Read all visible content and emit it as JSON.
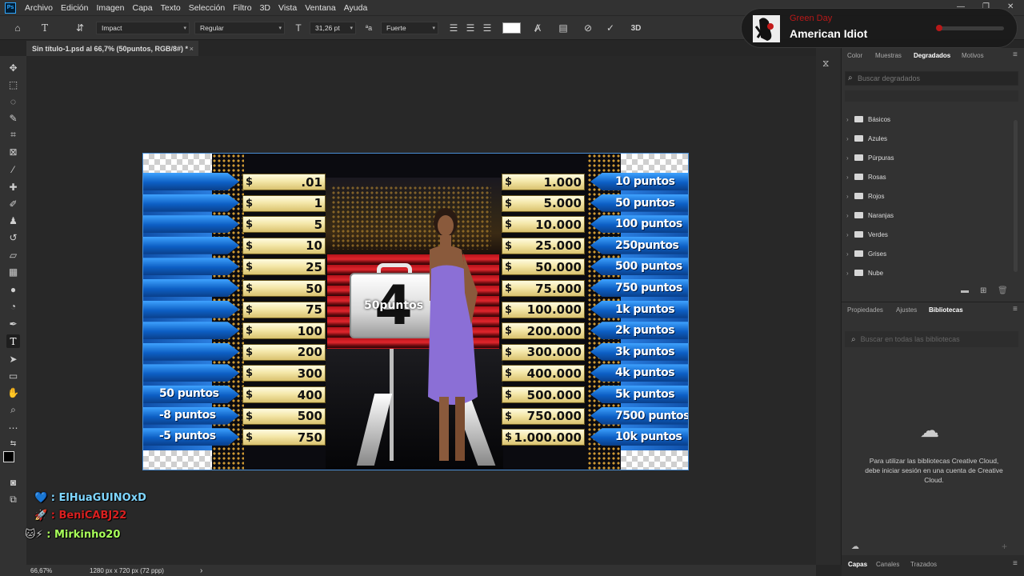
{
  "app": {
    "logo": "Ps"
  },
  "menu": [
    "Archivo",
    "Edición",
    "Imagen",
    "Capa",
    "Texto",
    "Selección",
    "Filtro",
    "3D",
    "Vista",
    "Ventana",
    "Ayuda"
  ],
  "options": {
    "font_family": "Impact",
    "font_style": "Regular",
    "font_size": "31,26 pt",
    "aa_icon": "ªa",
    "antialias": "Fuerte",
    "label_3d": "3D"
  },
  "document": {
    "tab_title": "Sin título-1.psd al 66,7% (50puntos, RGB/8#) *",
    "close": "×"
  },
  "status": {
    "zoom": "66,67%",
    "dimensions": "1280 px x 720 px (72 ppp)",
    "arrow": "›"
  },
  "game": {
    "left_amounts": [
      ".01",
      "1",
      "5",
      "10",
      "25",
      "50",
      "75",
      "100",
      "200",
      "300",
      "400",
      "500",
      "750"
    ],
    "right_amounts": [
      "1.000",
      "5.000",
      "10.000",
      "25.000",
      "50.000",
      "75.000",
      "100.000",
      "200.000",
      "300.000",
      "400.000",
      "500.000",
      "750.000",
      "1.000.000"
    ],
    "currency": "$",
    "right_labels": [
      "10 puntos",
      "50 puntos",
      "100 puntos",
      "250puntos",
      "500 puntos",
      "750 puntos",
      "1k puntos",
      "2k puntos",
      "3k puntos",
      "4k puntos",
      "5k puntos",
      "7500 puntos",
      "10k puntos"
    ],
    "left_labels": [
      "50 puntos",
      "-8 puntos",
      "-5 puntos"
    ],
    "case_number": "4",
    "case_label": "50puntos"
  },
  "music": {
    "artist": "Green Day",
    "title": "American Idiot",
    "accent": "#b81818"
  },
  "panels": {
    "top_tabs": [
      "Color",
      "Muestras",
      "Degradados",
      "Motivos"
    ],
    "top_active": "Degradados",
    "search_placeholder": "Buscar degradados",
    "folders": [
      "Básicos",
      "Azules",
      "Púrpuras",
      "Rosas",
      "Rojos",
      "Naranjas",
      "Verdes",
      "Grises",
      "Nube"
    ],
    "mid_tabs": [
      "Propiedades",
      "Ajustes",
      "Bibliotecas"
    ],
    "mid_active": "Bibliotecas",
    "lib_search_placeholder": "Buscar en todas las bibliotecas",
    "cc_message": "Para utilizar las bibliotecas Creative Cloud, debe iniciar sesión en una cuenta de Creative Cloud.",
    "bottom_tabs": [
      "Capas",
      "Canales",
      "Trazados"
    ],
    "bottom_active": "Capas"
  },
  "chat": [
    {
      "icon": "💙",
      "user": "ElHuaGUINOxD",
      "color": "#7fd6ff"
    },
    {
      "icon": "🚀",
      "user": "BeniCABJ22",
      "color": "#d92020"
    },
    {
      "icon": "🐱⚡",
      "user": "Mirkinho20",
      "color": "#a8ff5a"
    }
  ],
  "chat_sep": ":"
}
